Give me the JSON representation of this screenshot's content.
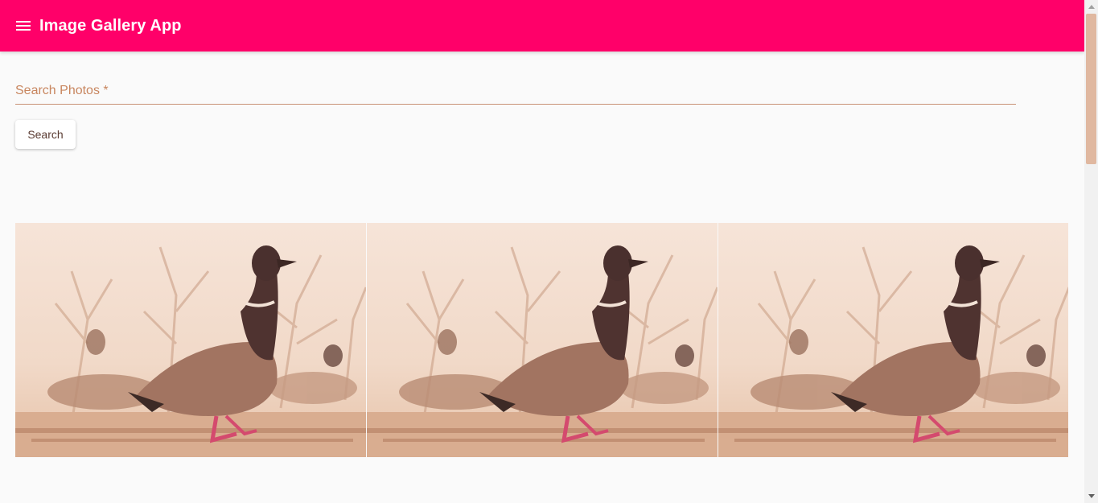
{
  "appbar": {
    "title": "Image Gallery App",
    "menu_icon": "menu-icon",
    "color": "#ff0069"
  },
  "search": {
    "placeholder": "Search Photos *",
    "value": "",
    "button_label": "Search"
  },
  "gallery": {
    "images": [
      {
        "subject": "duck-photo"
      },
      {
        "subject": "duck-photo"
      },
      {
        "subject": "duck-photo"
      }
    ]
  },
  "scrollbar": {
    "up_icon": "scroll-up-icon",
    "down_icon": "scroll-down-icon"
  }
}
